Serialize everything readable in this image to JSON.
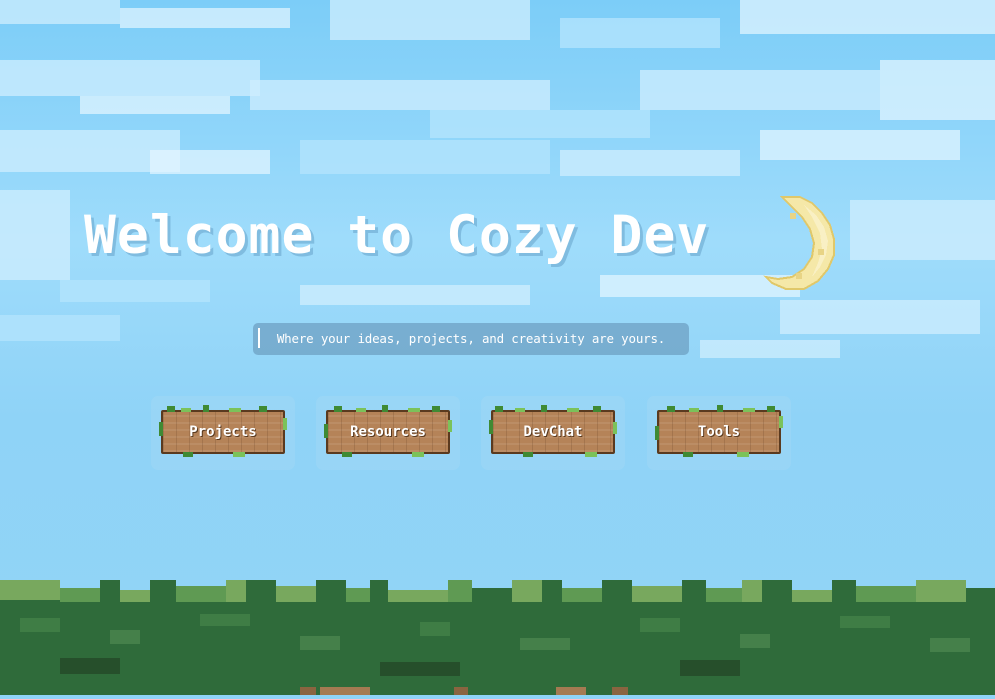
{
  "hero": {
    "title": "Welcome to Cozy Dev",
    "subtitle": "Where your ideas, projects, and creativity are yours."
  },
  "nav": {
    "items": [
      {
        "label": "Projects"
      },
      {
        "label": "Resources"
      },
      {
        "label": "DevChat"
      },
      {
        "label": "Tools"
      }
    ]
  },
  "icons": {
    "moon": "crescent-moon-icon"
  },
  "colors": {
    "sky": "#8fd3f7",
    "moon": "#f5e8a8",
    "sign_wood": "#b58358",
    "grass_dark": "#2f6b3a",
    "grass_light": "#78a85e"
  }
}
